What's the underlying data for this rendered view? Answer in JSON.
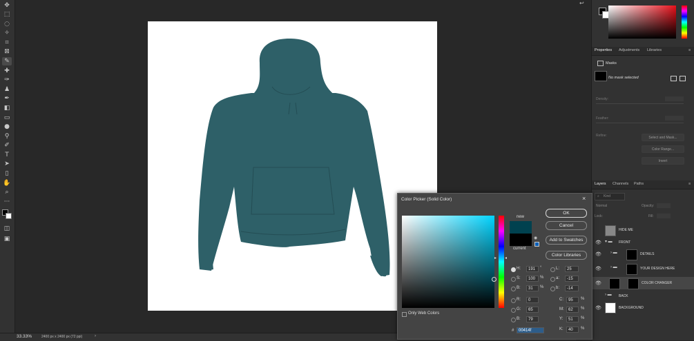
{
  "statusbar": {
    "zoom": "33.33%",
    "doc_info": "2400 px x 2400 px (72 ppi)"
  },
  "properties": {
    "tabs": [
      "Properties",
      "Adjustments",
      "Libraries"
    ],
    "section": "Masks",
    "no_mask": "No mask selected",
    "density_label": "Density:",
    "feather_label": "Feather:",
    "refine_label": "Refine:",
    "select_mask_btn": "Select and Mask...",
    "color_range_btn": "Color Range...",
    "invert_btn": "Invert"
  },
  "layers": {
    "tabs": [
      "Layers",
      "Channels",
      "Paths"
    ],
    "kind_label": "Kind",
    "blend_mode": "Normal",
    "opacity_label": "Opacity:",
    "lock_label": "Lock:",
    "fill_label": "Fill:",
    "items": [
      {
        "name": "HIDE ME"
      },
      {
        "name": "FRONT"
      },
      {
        "name": "DETAILS"
      },
      {
        "name": "YOUR DESIGN HERE"
      },
      {
        "name": "COLOR CHANGER"
      },
      {
        "name": "BACK"
      },
      {
        "name": "BACKGROUND"
      }
    ]
  },
  "color_picker": {
    "title": "Color Picker (Solid Color)",
    "ok": "OK",
    "cancel": "Cancel",
    "add_swatches": "Add to Swatches",
    "color_libraries": "Color Libraries",
    "new_label": "new",
    "current_label": "current",
    "new_color": "#00414f",
    "current_color": "#000000",
    "only_web": "Only Web Colors",
    "fields": {
      "H": {
        "label": "H:",
        "value": "191",
        "unit": "°"
      },
      "S": {
        "label": "S:",
        "value": "100",
        "unit": "%"
      },
      "B": {
        "label": "B:",
        "value": "31",
        "unit": "%"
      },
      "R": {
        "label": "R:",
        "value": "0"
      },
      "G": {
        "label": "G:",
        "value": "65"
      },
      "Bl": {
        "label": "B:",
        "value": "79"
      },
      "L": {
        "label": "L:",
        "value": "25"
      },
      "a": {
        "label": "a:",
        "value": "-15"
      },
      "b": {
        "label": "b:",
        "value": "-14"
      },
      "C": {
        "label": "C:",
        "value": "95",
        "unit": "%"
      },
      "M": {
        "label": "M:",
        "value": "62",
        "unit": "%"
      },
      "Y": {
        "label": "Y:",
        "value": "51",
        "unit": "%"
      },
      "K": {
        "label": "K:",
        "value": "40",
        "unit": "%"
      }
    },
    "hex_label": "#",
    "hex": "00414f"
  },
  "colors": {
    "hoodie": "#2e6068",
    "accent": "#00414f"
  }
}
